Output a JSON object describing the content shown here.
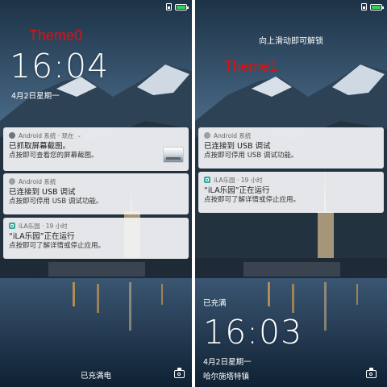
{
  "theme0": {
    "label": "Theme0",
    "time": "16:04",
    "date": "4月2日星期一",
    "charging_status": "已充满电",
    "notifications": [
      {
        "app": "Android 系统 · 现在",
        "title": "已抓取屏幕截图。",
        "body": "点按即可查看您的屏幕截图。",
        "icon": "android-icon",
        "has_thumbnail": true,
        "expand": "⌄"
      },
      {
        "app": "Android 系统",
        "title": "已连接到 USB 调试",
        "body": "点按即可停用 USB 调试功能。",
        "icon": "android-icon"
      },
      {
        "app": "iLA乐园 · 19 小时",
        "title": "“iLA乐园”正在运行",
        "body": "点按即可了解详情或停止应用。",
        "icon": "ila-icon"
      }
    ]
  },
  "theme1": {
    "label": "Theme1",
    "swipe_hint": "向上滑动即可解锁",
    "time": "16:03",
    "date": "4月2日星期一",
    "location": "哈尔施塔特镇",
    "charging_status": "已充满",
    "notifications": [
      {
        "app": "Android 系统",
        "title": "已连接到 USB 调试",
        "body": "点按即可停用 USB 调试功能。",
        "icon": "android-icon"
      },
      {
        "app": "iLA乐园 · 19 小时",
        "title": "“iLA乐园”正在运行",
        "body": "点按即可了解详情或停止应用。",
        "icon": "ila-icon"
      }
    ]
  },
  "status_bar": {
    "icons": [
      "sim-icon",
      "battery-icon"
    ],
    "battery_color": "#36d05a"
  },
  "colors": {
    "theme_label": "#e01010",
    "notification_bg": "#f3f4f6",
    "divider": "#ffffff"
  }
}
